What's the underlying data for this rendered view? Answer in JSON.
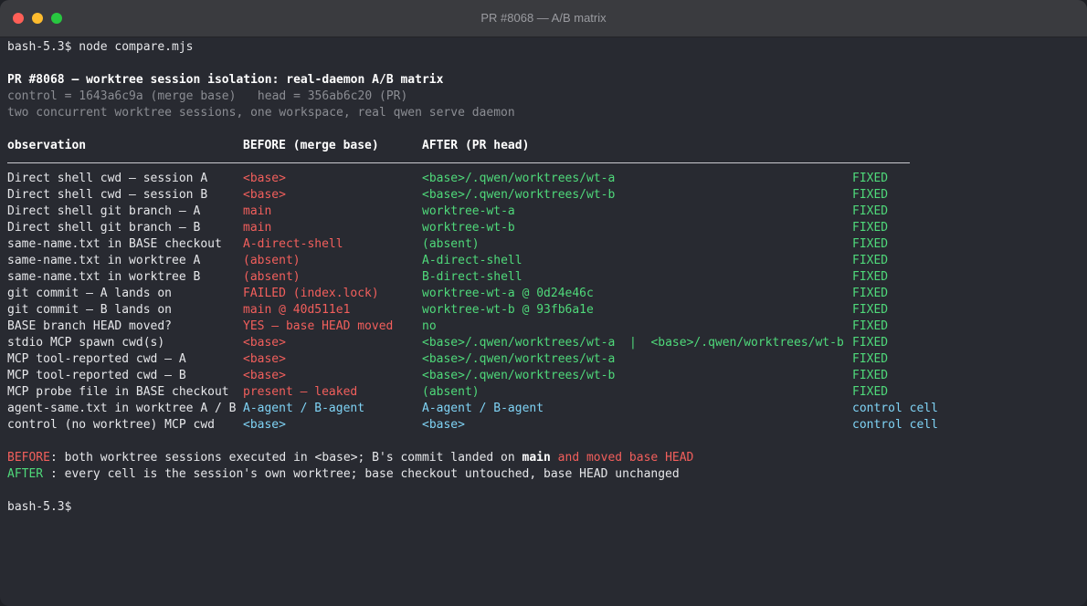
{
  "window": {
    "title": "PR #8068 — A/B matrix"
  },
  "terminal": {
    "prompt_line": "bash-5.3$ node compare.mjs",
    "heading": "PR #8068 — worktree session isolation: real-daemon A/B matrix",
    "subheading_1": "control = 1643a6c9a (merge base)   head = 356ab6c20 (PR)",
    "subheading_2": "two concurrent worktree sessions, one workspace, real qwen serve daemon",
    "columns": {
      "observation": "observation",
      "before": "BEFORE (merge base)",
      "after": "AFTER (PR head)"
    },
    "rows": [
      {
        "obs": "Direct shell cwd — session A",
        "before": "<base>",
        "after": "<base>/.qwen/worktrees/wt-a",
        "status": "FIXED"
      },
      {
        "obs": "Direct shell cwd — session B",
        "before": "<base>",
        "after": "<base>/.qwen/worktrees/wt-b",
        "status": "FIXED"
      },
      {
        "obs": "Direct shell git branch — A",
        "before": "main",
        "after": "worktree-wt-a",
        "status": "FIXED"
      },
      {
        "obs": "Direct shell git branch — B",
        "before": "main",
        "after": "worktree-wt-b",
        "status": "FIXED"
      },
      {
        "obs": "same-name.txt in BASE checkout",
        "before": "A-direct-shell",
        "after": "(absent)",
        "status": "FIXED"
      },
      {
        "obs": "same-name.txt in worktree A",
        "before": "(absent)",
        "after": "A-direct-shell",
        "status": "FIXED"
      },
      {
        "obs": "same-name.txt in worktree B",
        "before": "(absent)",
        "after": "B-direct-shell",
        "status": "FIXED"
      },
      {
        "obs": "git commit — A lands on",
        "before": "FAILED (index.lock)",
        "after": "worktree-wt-a @ 0d24e46c",
        "status": "FIXED"
      },
      {
        "obs": "git commit — B lands on",
        "before": "main @ 40d511e1",
        "after": "worktree-wt-b @ 93fb6a1e",
        "status": "FIXED"
      },
      {
        "obs": "BASE branch HEAD moved?",
        "before": "YES — base HEAD moved",
        "after": "no",
        "status": "FIXED"
      },
      {
        "obs": "stdio MCP spawn cwd(s)",
        "before": "<base>",
        "after": "<base>/.qwen/worktrees/wt-a  |  <base>/.qwen/worktrees/wt-b",
        "status": "FIXED"
      },
      {
        "obs": "MCP tool-reported cwd — A",
        "before": "<base>",
        "after": "<base>/.qwen/worktrees/wt-a",
        "status": "FIXED"
      },
      {
        "obs": "MCP tool-reported cwd — B",
        "before": "<base>",
        "after": "<base>/.qwen/worktrees/wt-b",
        "status": "FIXED"
      },
      {
        "obs": "MCP probe file in BASE checkout",
        "before": "present — leaked",
        "after": "(absent)",
        "status": "FIXED"
      },
      {
        "obs": "agent-same.txt in worktree A / B",
        "before": "A-agent / B-agent",
        "after": "A-agent / B-agent",
        "status": "control cell"
      },
      {
        "obs": "control (no worktree) MCP cwd",
        "before": "<base>",
        "after": "<base>",
        "status": "control cell"
      }
    ],
    "summary_before": {
      "label": "BEFORE",
      "text_1": ": both worktree sessions executed in <base>; B's commit landed on ",
      "emphasis": "main",
      "text_2": " and moved base HEAD"
    },
    "summary_after": {
      "label": "AFTER",
      "text": " : every cell is the session's own worktree; base checkout untouched, base HEAD unchanged"
    },
    "final_prompt": "bash-5.3$"
  },
  "colors": {
    "background": "#282a31",
    "before_red": "#f25f5c",
    "after_green": "#4fd97a",
    "control_cyan": "#7fd3f5"
  }
}
